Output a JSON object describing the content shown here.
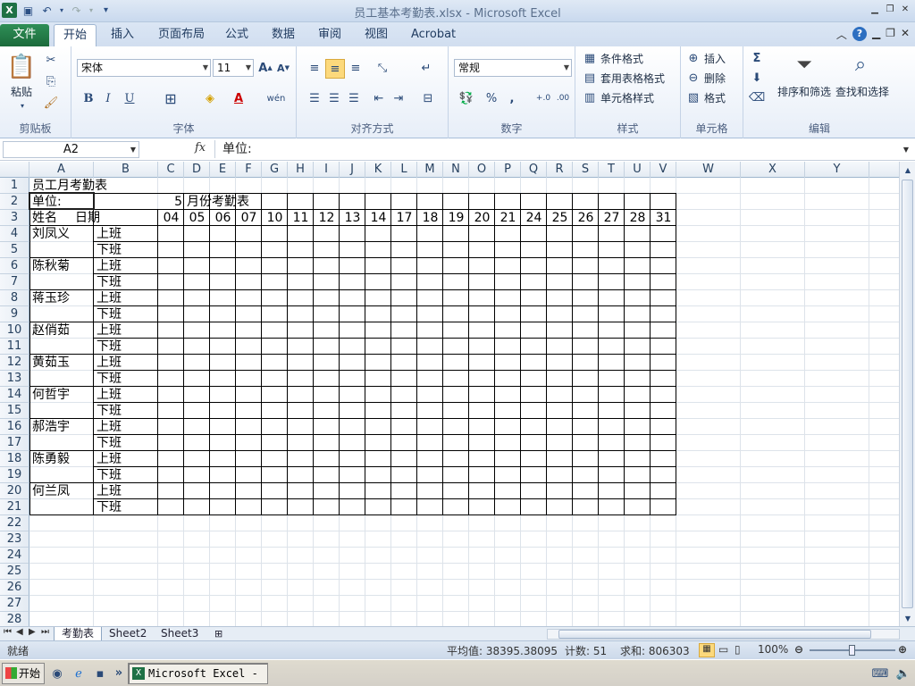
{
  "window": {
    "title": "员工基本考勤表.xlsx - Microsoft Excel"
  },
  "ribbon": {
    "tabs": [
      "文件",
      "开始",
      "插入",
      "页面布局",
      "公式",
      "数据",
      "审阅",
      "视图",
      "Acrobat"
    ],
    "active_tab": "开始",
    "clipboard": {
      "paste": "粘贴",
      "group": "剪贴板"
    },
    "font": {
      "name": "宋体",
      "size": "11",
      "group": "字体",
      "bold": "B",
      "italic": "I",
      "underline": "U"
    },
    "alignment": {
      "group": "对齐方式"
    },
    "number": {
      "format": "常规",
      "group": "数字",
      "percent": "%",
      "comma": ","
    },
    "styles": {
      "conditional": "条件格式",
      "table": "套用表格格式",
      "cell_styles": "单元格样式",
      "group": "样式"
    },
    "cells": {
      "insert": "插入",
      "delete": "删除",
      "format": "格式",
      "group": "单元格"
    },
    "editing": {
      "sort": "排序和筛选",
      "find": "查找和选择",
      "group": "编辑",
      "sigma": "Σ"
    }
  },
  "formula_bar": {
    "name_box": "A2",
    "fx": "fx",
    "content": "单位:"
  },
  "columns": [
    "A",
    "B",
    "C",
    "D",
    "E",
    "F",
    "G",
    "H",
    "I",
    "J",
    "K",
    "L",
    "M",
    "N",
    "O",
    "P",
    "Q",
    "R",
    "S",
    "T",
    "U",
    "V",
    "W",
    "X",
    "Y"
  ],
  "rows": [
    "1",
    "2",
    "3",
    "4",
    "5",
    "6",
    "7",
    "8",
    "9",
    "10",
    "11",
    "12",
    "13",
    "14",
    "15",
    "16",
    "17",
    "18",
    "19",
    "20",
    "21",
    "22",
    "23",
    "24",
    "25",
    "26",
    "27",
    "28"
  ],
  "sheet": {
    "title": "员工月考勤表",
    "unit_label": "单位:",
    "month_num": "5",
    "month_label": "月份考勤表",
    "header_name": "姓名",
    "header_date": "日期",
    "dates": [
      "04",
      "05",
      "06",
      "07",
      "10",
      "11",
      "12",
      "13",
      "14",
      "17",
      "18",
      "19",
      "20",
      "21",
      "24",
      "25",
      "26",
      "27",
      "28",
      "31"
    ],
    "employees": [
      {
        "name": "刘凤义",
        "am": "上班",
        "pm": "下班"
      },
      {
        "name": "陈秋菊",
        "am": "上班",
        "pm": "下班"
      },
      {
        "name": "蒋玉珍",
        "am": "上班",
        "pm": "下班"
      },
      {
        "name": "赵俏茹",
        "am": "上班",
        "pm": "下班"
      },
      {
        "name": "黄茹玉",
        "am": "上班",
        "pm": "下班"
      },
      {
        "name": "何哲宇",
        "am": "上班",
        "pm": "下班"
      },
      {
        "name": "郝浩宇",
        "am": "上班",
        "pm": "下班"
      },
      {
        "name": "陈勇毅",
        "am": "上班",
        "pm": "下班"
      },
      {
        "name": "何兰凤",
        "am": "上班",
        "pm": "下班"
      }
    ]
  },
  "sheet_tabs": [
    "考勤表",
    "Sheet2",
    "Sheet3"
  ],
  "status": {
    "ready": "就绪",
    "average": "平均值: 38395.38095",
    "count": "计数: 51",
    "sum": "求和: 806303",
    "zoom": "100%"
  },
  "taskbar": {
    "start": "开始",
    "item": "Microsoft Excel - ..."
  }
}
